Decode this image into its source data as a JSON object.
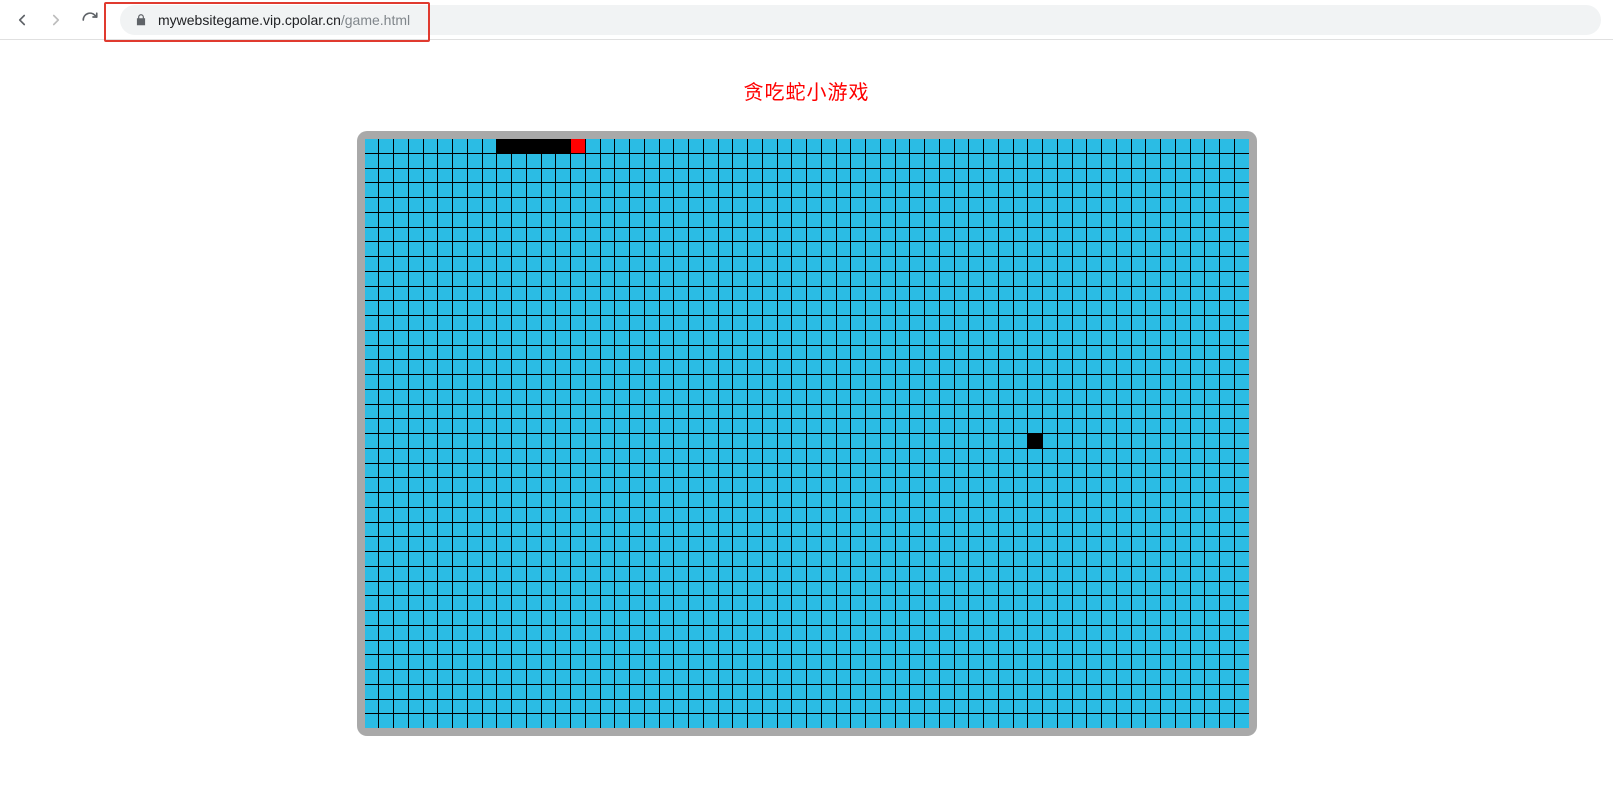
{
  "browser": {
    "url_domain": "mywebsitegame.vip.cpolar.cn",
    "url_path": "/game.html"
  },
  "page": {
    "title": "贪吃蛇小游戏"
  },
  "game": {
    "grid": {
      "cols": 60,
      "rows": 40
    },
    "colors": {
      "cell_bg": "#2bbce4",
      "grid_line": "#000000",
      "snake_body": "#000000",
      "snake_head": "#ff0000",
      "food": "#000000",
      "frame": "#a9a9a9",
      "title": "#ff0000"
    },
    "snake": {
      "body": [
        {
          "r": 0,
          "c": 9
        },
        {
          "r": 0,
          "c": 10
        },
        {
          "r": 0,
          "c": 11
        },
        {
          "r": 0,
          "c": 12
        },
        {
          "r": 0,
          "c": 13
        }
      ],
      "head": {
        "r": 0,
        "c": 14
      }
    },
    "food": {
      "r": 20,
      "c": 45
    }
  },
  "annotation": {
    "highlight_url": true
  }
}
